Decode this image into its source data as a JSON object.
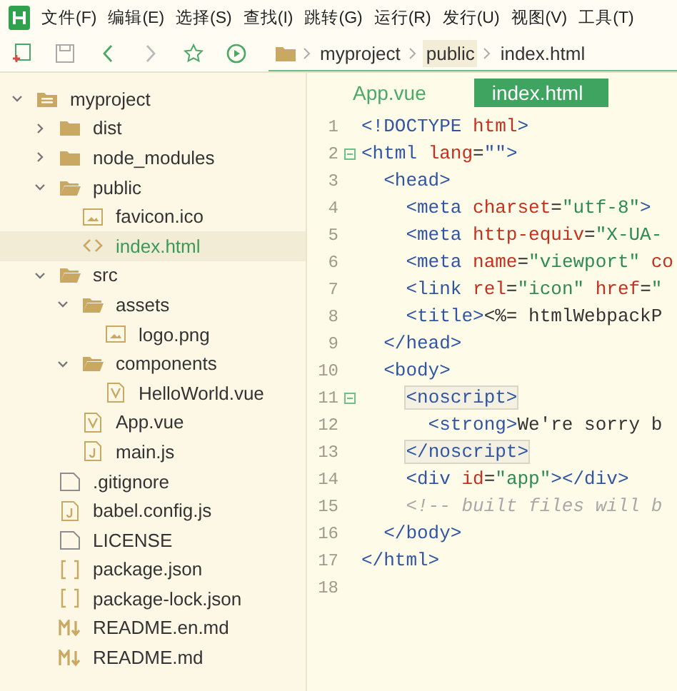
{
  "menu": {
    "items": [
      "文件(F)",
      "编辑(E)",
      "选择(S)",
      "查找(I)",
      "跳转(G)",
      "运行(R)",
      "发行(U)",
      "视图(V)",
      "工具(T)"
    ]
  },
  "toolbar": {
    "breadcrumb": [
      {
        "label": "myproject",
        "selected": false
      },
      {
        "label": "public",
        "selected": true
      },
      {
        "label": "index.html",
        "selected": false
      }
    ]
  },
  "sidebar": {
    "tree": [
      {
        "name": "myproject",
        "kind": "project",
        "expanded": true,
        "selected": false,
        "children": [
          {
            "name": "dist",
            "kind": "folder",
            "expanded": false,
            "selected": false
          },
          {
            "name": "node_modules",
            "kind": "folder",
            "expanded": false,
            "selected": false
          },
          {
            "name": "public",
            "kind": "folder",
            "expanded": true,
            "selected": false,
            "children": [
              {
                "name": "favicon.ico",
                "kind": "image",
                "selected": false
              },
              {
                "name": "index.html",
                "kind": "html",
                "selected": true
              }
            ]
          },
          {
            "name": "src",
            "kind": "folder",
            "expanded": true,
            "selected": false,
            "children": [
              {
                "name": "assets",
                "kind": "folder",
                "expanded": true,
                "selected": false,
                "children": [
                  {
                    "name": "logo.png",
                    "kind": "image",
                    "selected": false
                  }
                ]
              },
              {
                "name": "components",
                "kind": "folder",
                "expanded": true,
                "selected": false,
                "children": [
                  {
                    "name": "HelloWorld.vue",
                    "kind": "vue",
                    "selected": false
                  }
                ]
              },
              {
                "name": "App.vue",
                "kind": "vue",
                "selected": false
              },
              {
                "name": "main.js",
                "kind": "js",
                "selected": false
              }
            ]
          },
          {
            "name": ".gitignore",
            "kind": "file",
            "selected": false
          },
          {
            "name": "babel.config.js",
            "kind": "js",
            "selected": false
          },
          {
            "name": "LICENSE",
            "kind": "file",
            "selected": false
          },
          {
            "name": "package.json",
            "kind": "json",
            "selected": false
          },
          {
            "name": "package-lock.json",
            "kind": "json",
            "selected": false
          },
          {
            "name": "README.en.md",
            "kind": "markdown",
            "selected": false
          },
          {
            "name": "README.md",
            "kind": "markdown",
            "selected": false
          }
        ]
      }
    ]
  },
  "editor": {
    "tabs": [
      {
        "label": "App.vue",
        "selected": false
      },
      {
        "label": "index.html",
        "selected": true
      }
    ],
    "lines": [
      {
        "number": "1",
        "fold": false,
        "tokens": [
          {
            "kind": "tag",
            "text": "<!DOCTYPE "
          },
          {
            "kind": "attr",
            "text": "html"
          },
          {
            "kind": "tag",
            "text": ">"
          }
        ]
      },
      {
        "number": "2",
        "fold": true,
        "tokens": [
          {
            "kind": "tag",
            "text": "<html "
          },
          {
            "kind": "attr",
            "text": "lang"
          },
          {
            "kind": "plain",
            "text": "="
          },
          {
            "kind": "tag",
            "text": "\"\">"
          }
        ]
      },
      {
        "number": "3",
        "fold": false,
        "tokens": [
          {
            "kind": "tag",
            "text": "  <head>"
          }
        ]
      },
      {
        "number": "4",
        "fold": false,
        "tokens": [
          {
            "kind": "tag",
            "text": "    <meta "
          },
          {
            "kind": "attr",
            "text": "charset"
          },
          {
            "kind": "plain",
            "text": "="
          },
          {
            "kind": "string",
            "text": "\"utf-8\""
          },
          {
            "kind": "tag",
            "text": ">"
          }
        ]
      },
      {
        "number": "5",
        "fold": false,
        "tokens": [
          {
            "kind": "tag",
            "text": "    <meta "
          },
          {
            "kind": "attr",
            "text": "http-equiv"
          },
          {
            "kind": "plain",
            "text": "="
          },
          {
            "kind": "string",
            "text": "\"X-UA-"
          }
        ]
      },
      {
        "number": "6",
        "fold": false,
        "tokens": [
          {
            "kind": "tag",
            "text": "    <meta "
          },
          {
            "kind": "attr",
            "text": "name"
          },
          {
            "kind": "plain",
            "text": "="
          },
          {
            "kind": "string",
            "text": "\"viewport\" "
          },
          {
            "kind": "attr",
            "text": "co"
          }
        ]
      },
      {
        "number": "7",
        "fold": false,
        "tokens": [
          {
            "kind": "tag",
            "text": "    <link "
          },
          {
            "kind": "attr",
            "text": "rel"
          },
          {
            "kind": "plain",
            "text": "="
          },
          {
            "kind": "string",
            "text": "\"icon\" "
          },
          {
            "kind": "attr",
            "text": "href"
          },
          {
            "kind": "plain",
            "text": "="
          },
          {
            "kind": "string",
            "text": "\""
          }
        ]
      },
      {
        "number": "8",
        "fold": false,
        "tokens": [
          {
            "kind": "tag",
            "text": "    <title>"
          },
          {
            "kind": "plain",
            "text": "<%= htmlWebpackP"
          }
        ]
      },
      {
        "number": "9",
        "fold": false,
        "tokens": [
          {
            "kind": "tag",
            "text": "  </head>"
          }
        ]
      },
      {
        "number": "10",
        "fold": false,
        "tokens": [
          {
            "kind": "tag",
            "text": "  <body>"
          }
        ]
      },
      {
        "number": "11",
        "fold": true,
        "tokens": [
          {
            "kind": "match",
            "text": "    <noscript>"
          }
        ]
      },
      {
        "number": "12",
        "fold": false,
        "tokens": [
          {
            "kind": "tag",
            "text": "      <strong>"
          },
          {
            "kind": "plain",
            "text": "We're sorry b"
          }
        ]
      },
      {
        "number": "13",
        "fold": false,
        "tokens": [
          {
            "kind": "match",
            "text": "    </noscript>"
          }
        ]
      },
      {
        "number": "14",
        "fold": false,
        "tokens": [
          {
            "kind": "tag",
            "text": "    <div "
          },
          {
            "kind": "attr",
            "text": "id"
          },
          {
            "kind": "plain",
            "text": "="
          },
          {
            "kind": "string",
            "text": "\"app\""
          },
          {
            "kind": "tag",
            "text": "></div>"
          }
        ]
      },
      {
        "number": "15",
        "fold": false,
        "tokens": [
          {
            "kind": "comment",
            "text": "    <!-- built files will b"
          }
        ]
      },
      {
        "number": "16",
        "fold": false,
        "tokens": [
          {
            "kind": "tag",
            "text": "  </body>"
          }
        ]
      },
      {
        "number": "17",
        "fold": false,
        "tokens": [
          {
            "kind": "tag",
            "text": "</html>"
          }
        ]
      },
      {
        "number": "18",
        "fold": false
      }
    ]
  }
}
